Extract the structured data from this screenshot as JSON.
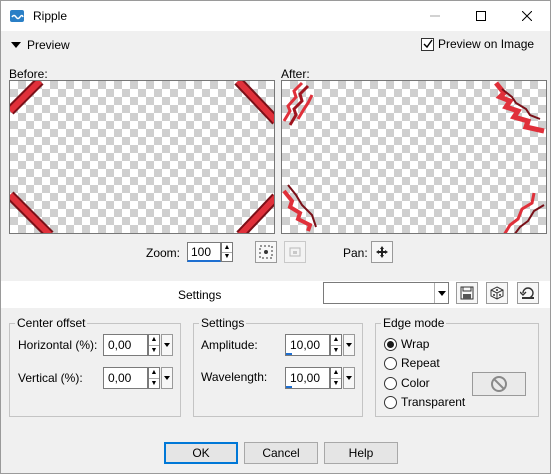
{
  "window": {
    "title": "Ripple"
  },
  "icons": {
    "app": "ripple-app-icon",
    "minimize": "minimize-icon",
    "maximize": "maximize-icon",
    "close": "close-icon"
  },
  "preview": {
    "toggle_label": "Preview",
    "preview_on_image_label": "Preview on Image",
    "preview_on_image_checked": true,
    "before_label": "Before:",
    "after_label": "After:"
  },
  "zoom": {
    "label": "Zoom:",
    "value": "100"
  },
  "pan": {
    "label": "Pan:"
  },
  "settings_bar": {
    "label": "Settings",
    "preset_value": ""
  },
  "center_offset": {
    "title": "Center offset",
    "horizontal_label": "Horizontal (%):",
    "horizontal_value": "0,00",
    "vertical_label": "Vertical (%):",
    "vertical_value": "0,00"
  },
  "settings_group": {
    "title": "Settings",
    "amplitude_label": "Amplitude:",
    "amplitude_value": "10,00",
    "wavelength_label": "Wavelength:",
    "wavelength_value": "10,00"
  },
  "edge_mode": {
    "title": "Edge mode",
    "options": [
      "Wrap",
      "Repeat",
      "Color",
      "Transparent"
    ],
    "selected": "Wrap"
  },
  "buttons": {
    "ok": "OK",
    "cancel": "Cancel",
    "help": "Help"
  },
  "colors": {
    "accent": "#1e6fd1",
    "stripe_red": "#e0303a",
    "stripe_dark": "#7a1018"
  }
}
